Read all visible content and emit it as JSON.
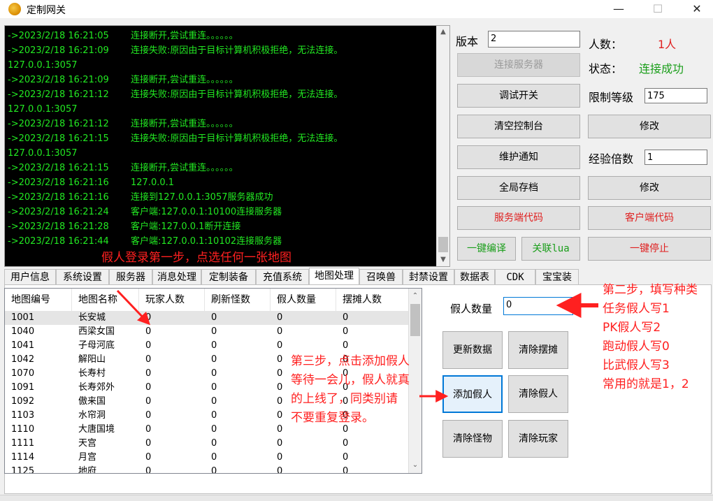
{
  "window": {
    "title": "定制网关",
    "minimize": "—",
    "maximize": "☐",
    "close": "✕"
  },
  "console": {
    "lines": [
      {
        "ts": "->2023/2/18 16:21:05",
        "msg": "连接断开,尝试重连。。。。。。"
      },
      {
        "ts": "->2023/2/18 16:21:09",
        "msg": "连接失败:原因由于目标计算机积极拒绝，无法连接。"
      },
      {
        "ts": "127.0.0.1:3057",
        "msg": ""
      },
      {
        "ts": "->2023/2/18 16:21:09",
        "msg": "连接断开,尝试重连。。。。。。"
      },
      {
        "ts": "->2023/2/18 16:21:12",
        "msg": "连接失败:原因由于目标计算机积极拒绝，无法连接。"
      },
      {
        "ts": "127.0.0.1:3057",
        "msg": ""
      },
      {
        "ts": "->2023/2/18 16:21:12",
        "msg": "连接断开,尝试重连。。。。。。"
      },
      {
        "ts": "->2023/2/18 16:21:15",
        "msg": "连接失败:原因由于目标计算机积极拒绝，无法连接。"
      },
      {
        "ts": "127.0.0.1:3057",
        "msg": ""
      },
      {
        "ts": "->2023/2/18 16:21:15",
        "msg": "连接断开,尝试重连。。。。。。"
      },
      {
        "ts": "->2023/2/18 16:21:16",
        "msg": "127.0.0.1"
      },
      {
        "ts": "->2023/2/18 16:21:16",
        "msg": "连接到127.0.0.1:3057服务器成功"
      },
      {
        "ts": "->2023/2/18 16:21:24",
        "msg": "客户端:127.0.0.1:10100连接服务器"
      },
      {
        "ts": "->2023/2/18 16:21:28",
        "msg": "客户端:127.0.0.1断开连接"
      },
      {
        "ts": "->2023/2/18 16:21:44",
        "msg": "客户端:127.0.0.1:10102连接服务器"
      }
    ]
  },
  "annotations": {
    "step1": "假人登录第一步，点选任何一张地图",
    "step2": [
      "第二步，填写种类",
      "任务假人写1",
      "PK假人写2",
      "跑动假人写0",
      "比武假人写3",
      "常用的就是1，2"
    ],
    "step3": [
      "第三步，点击添加假人",
      "等待一会儿，假人就真",
      "的上线了，同类别请",
      "不要重复登录。"
    ]
  },
  "right_panel": {
    "version_label": "版本",
    "version_value": "2",
    "people_label": "人数：",
    "people_value": "1人",
    "status_label": "状态：",
    "status_value": "连接成功",
    "connect_button": "连接服务器",
    "debug_button": "调试开关",
    "level_label": "限制等级",
    "level_value": "175",
    "clear_console_button": "清空控制台",
    "modify_button_1": "修改",
    "maintenance_button": "维护通知",
    "exp_label": "经验倍数",
    "exp_value": "1",
    "save_all_button": "全局存档",
    "modify_button_2": "修改",
    "server_code_button": "服务端代码",
    "client_code_button": "客户端代码",
    "compile_button": "一键编译",
    "lua_button": "关联lua",
    "stop_button": "一键停止"
  },
  "tabs": [
    "用户信息",
    "系统设置",
    "服务器",
    "消息处理",
    "定制装备",
    "充值系统",
    "地图处理",
    "召唤兽",
    "封禁设置",
    "数据表",
    "CDK",
    "宝宝装"
  ],
  "active_tab": "地图处理",
  "map_table": {
    "headers": [
      "地图编号",
      "地图名称",
      "玩家人数",
      "刷新怪数",
      "假人数量",
      "摆摊人数"
    ],
    "rows": [
      [
        "1001",
        "长安城",
        "0",
        "0",
        "0",
        "0"
      ],
      [
        "1040",
        "西梁女国",
        "0",
        "0",
        "0",
        "0"
      ],
      [
        "1041",
        "子母河底",
        "0",
        "0",
        "0",
        "0"
      ],
      [
        "1042",
        "解阳山",
        "0",
        "0",
        "0",
        "0"
      ],
      [
        "1070",
        "长寿村",
        "0",
        "0",
        "0",
        "0"
      ],
      [
        "1091",
        "长寿郊外",
        "0",
        "0",
        "0",
        "0"
      ],
      [
        "1092",
        "傲来国",
        "0",
        "0",
        "0",
        "0"
      ],
      [
        "1103",
        "水帘洞",
        "0",
        "0",
        "0",
        "0"
      ],
      [
        "1110",
        "大唐国境",
        "0",
        "0",
        "0",
        "0"
      ],
      [
        "1111",
        "天宫",
        "0",
        "0",
        "0",
        "0"
      ],
      [
        "1114",
        "月宫",
        "0",
        "0",
        "0",
        "0"
      ],
      [
        "1125",
        "地府",
        "0",
        "0",
        "0",
        "0"
      ]
    ]
  },
  "map_controls": {
    "fake_count_label": "假人数量",
    "fake_count_value": "0",
    "refresh_button": "更新数据",
    "clear_stalls_button": "清除摆摊",
    "add_fake_button": "添加假人",
    "clear_fake_button": "清除假人",
    "clear_monsters_button": "清除怪物",
    "clear_players_button": "清除玩家"
  },
  "colors": {
    "console_text": "#22e822",
    "annotation": "#ff2020",
    "status_ok": "#1a9e1a"
  }
}
